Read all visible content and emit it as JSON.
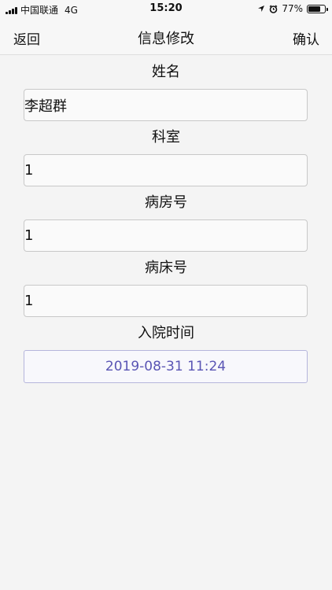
{
  "status_bar": {
    "carrier": "中国联通",
    "network": "4G",
    "time": "15:20",
    "battery": "77%",
    "battery_level": 0.77
  },
  "nav": {
    "back_label": "返回",
    "title": "信息修改",
    "confirm_label": "确认"
  },
  "form": {
    "name": {
      "label": "姓名",
      "value": "李超群"
    },
    "department": {
      "label": "科室",
      "value": "1"
    },
    "room": {
      "label": "病房号",
      "value": "1"
    },
    "bed": {
      "label": "病床号",
      "value": "1"
    },
    "admission": {
      "label": "入院时间",
      "value": "2019-08-31 11:24"
    }
  },
  "colors": {
    "background": "#f4f4f4",
    "date_text": "#5a55b4",
    "date_border": "#b5b5dc"
  }
}
